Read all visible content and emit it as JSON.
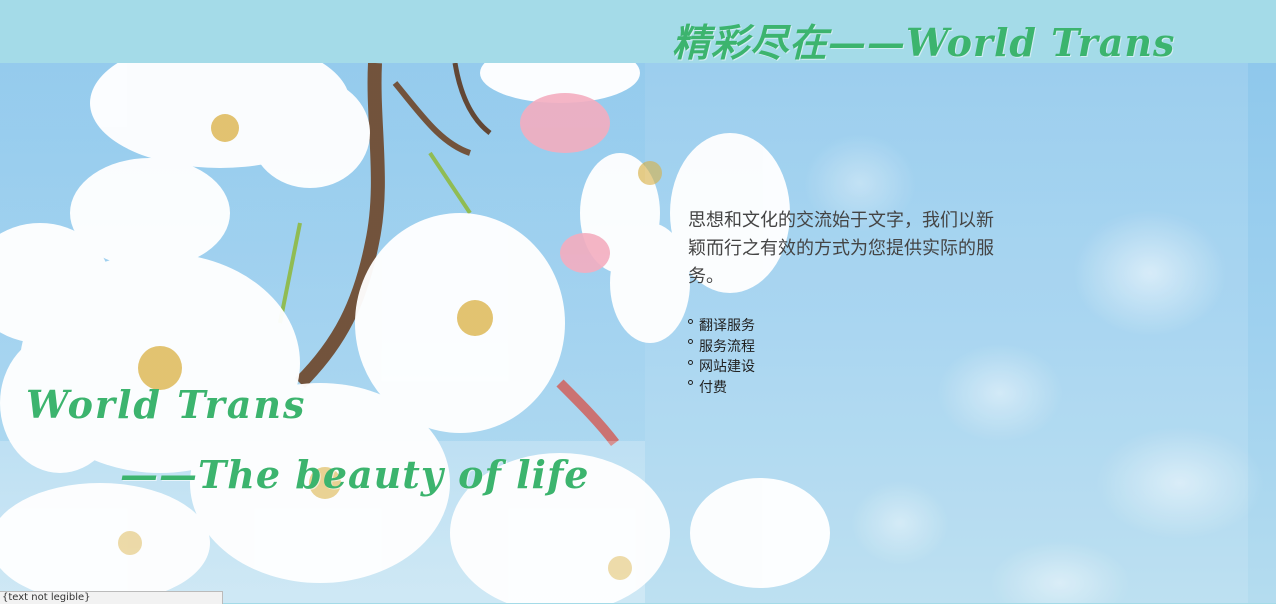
{
  "colors": {
    "accent_green": "#3cb46e",
    "sky": "#a4dbe8"
  },
  "headline": "精彩尽在——World Trans",
  "intro": "思想和文化的交流始于文字，我们以新颖而行之有效的方式为您提供实际的服务。",
  "menu": [
    {
      "label": "翻译服务"
    },
    {
      "label": "服务流程"
    },
    {
      "label": "网站建设"
    },
    {
      "label": "付费"
    }
  ],
  "slogan": {
    "line1": "World Trans",
    "line2": "——The beauty of life"
  },
  "status": "{text not legible}"
}
